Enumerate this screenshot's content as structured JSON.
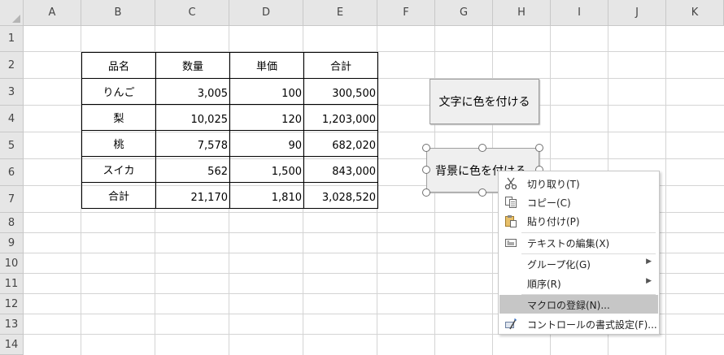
{
  "columns": [
    "A",
    "B",
    "C",
    "D",
    "E",
    "F",
    "G",
    "H",
    "I",
    "J",
    "K"
  ],
  "rows": [
    "1",
    "2",
    "3",
    "4",
    "5",
    "6",
    "7",
    "8",
    "9",
    "10",
    "11",
    "12",
    "13",
    "14"
  ],
  "table": {
    "header": [
      "品名",
      "数量",
      "単価",
      "合計"
    ],
    "rows": [
      [
        "りんご",
        "3,005",
        "100",
        "300,500"
      ],
      [
        "梨",
        "10,025",
        "120",
        "1,203,000"
      ],
      [
        "桃",
        "7,578",
        "90",
        "682,020"
      ],
      [
        "スイカ",
        "562",
        "1,500",
        "843,000"
      ],
      [
        "合計",
        "21,170",
        "1,810",
        "3,028,520"
      ]
    ]
  },
  "buttons": {
    "text_color": "文字に色を付ける",
    "bg_color": "背景に色を付ける"
  },
  "context_menu": {
    "items": [
      {
        "label": "切り取り(T)",
        "icon": "scissors-icon"
      },
      {
        "label": "コピー(C)",
        "icon": "copy-icon"
      },
      {
        "label": "貼り付け(P)",
        "icon": "paste-icon"
      },
      {
        "label": "テキストの編集(X)",
        "icon": "edit-text-icon"
      },
      {
        "label": "グループ化(G)",
        "submenu": true
      },
      {
        "label": "順序(R)",
        "submenu": true
      },
      {
        "label": "マクロの登録(N)...",
        "highlighted": true
      },
      {
        "label": "コントロールの書式設定(F)...",
        "icon": "format-control-icon"
      }
    ]
  },
  "colors": {
    "header_bg": "#e6e6e6",
    "gridline": "#d4d4d4",
    "menu_highlight": "#c6c6c6"
  }
}
